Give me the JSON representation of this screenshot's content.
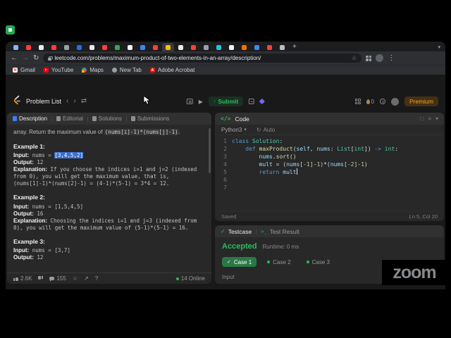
{
  "screen": {
    "watermark": "zoom"
  },
  "icons": {
    "back": "←",
    "forward": "→",
    "reload": "↻",
    "menu": "⋮",
    "star": "☆",
    "caret_down": "▾",
    "chevron_left": "‹",
    "chevron_right": "›",
    "shuffle": "⇄",
    "run": "▶",
    "upload": "↑",
    "share": "↗",
    "help": "?",
    "check": "✓",
    "terminal": ">_",
    "code": "</>",
    "square": "□",
    "lines": "≡"
  },
  "browser": {
    "tab_strip": {
      "favicon_colors": [
        "#8ab4f8",
        "#ff3d3d",
        "#e8eaed",
        "#ff3d3d",
        "#9aa0a6",
        "#1a73e8",
        "#e8eaed",
        "#ff3d3d",
        "#34a853",
        "#f4f4f4",
        "#4285f4",
        "#ff3d3d",
        "#fbbc04",
        "#ececec",
        "#ff3d3d",
        "#9aa0a6",
        "#26c6da",
        "#f1f1f1",
        "#ff6d00",
        "#4285f4",
        "#ff3d3d",
        "#bdbdbd"
      ],
      "active_index": 12,
      "new_tab_label": "+"
    },
    "toolbar": {
      "url": "leetcode.com/problems/maximum-product-of-two-elements-in-an-array/description/"
    },
    "bookmarks": [
      {
        "label": "Gmail",
        "icon": "gmail-icon",
        "bg": "#ffffff",
        "glyph": "M",
        "glyph_color": "#ea4335"
      },
      {
        "label": "YouTube",
        "icon": "youtube-icon",
        "bg": "#ff0000",
        "glyph": "",
        "glyph_color": ""
      },
      {
        "label": "Maps",
        "icon": "maps-icon",
        "bg": "",
        "glyph": "",
        "glyph_color": ""
      },
      {
        "label": "New Tab",
        "icon": "new-tab-icon",
        "bg": "#9aa0a6",
        "glyph": "",
        "glyph_color": ""
      },
      {
        "label": "Adobe Acrobat",
        "icon": "acrobat-icon",
        "bg": "#fa0f00",
        "glyph": "A",
        "glyph_color": "#ffffff"
      }
    ]
  },
  "leetcode": {
    "nav": {
      "problem_list": "Problem List",
      "submit": "Submit",
      "streak": "0",
      "premium": "Premium"
    },
    "description": {
      "tabs": [
        {
          "label": "Description",
          "color": "#3e7eff",
          "active": true
        },
        {
          "label": "Editorial",
          "color": "#8f8f8f",
          "active": false
        },
        {
          "label": "Solutions",
          "color": "#8f8f8f",
          "active": false
        },
        {
          "label": "Submissions",
          "color": "#8f8f8f",
          "active": false
        }
      ],
      "intro_pre": "array. Return the maximum value of ",
      "intro_code": "(nums[i]-1)*(nums[j]-1)",
      "intro_post": ".",
      "examples": [
        {
          "title": "Example 1:",
          "input_label": "Input:",
          "input_pre": " nums = ",
          "input_selected": "[3,4,5,2]",
          "output_label": "Output:",
          "output_value": " 12",
          "explanation_label": "Explanation:",
          "explanation": " If you choose the indices i=1 and j=2 (indexed from 0), you will get the maximum value, that is, (nums[1]-1)*(nums[2]-1) = (4-1)*(5-1) = 3*4 = 12."
        },
        {
          "title": "Example 2:",
          "input_label": "Input:",
          "input_value": " nums = [1,5,4,5]",
          "output_label": "Output:",
          "output_value": " 16",
          "explanation_label": "Explanation:",
          "explanation": " Choosing the indices i=1 and j=3 (indexed from 0), you will get the maximum value of (5-1)*(5-1) = 16."
        },
        {
          "title": "Example 3:",
          "input_label": "Input:",
          "input_value": " nums = [3,7]",
          "output_label": "Output:",
          "output_value": " 12"
        }
      ],
      "footer": {
        "likes": "2.6K",
        "comments": "155",
        "online": "14 Online"
      }
    },
    "code_panel": {
      "title": "Code",
      "language": "Python3",
      "auto": "Auto",
      "lines": [
        [
          {
            "t": "class ",
            "c": "kw"
          },
          {
            "t": "Solution",
            "c": "type"
          },
          {
            "t": ":",
            "c": "pln"
          }
        ],
        [
          {
            "t": "    ",
            "c": "pln"
          },
          {
            "t": "def ",
            "c": "kw"
          },
          {
            "t": "maxProduct",
            "c": "fn"
          },
          {
            "t": "(",
            "c": "pln"
          },
          {
            "t": "self",
            "c": "var"
          },
          {
            "t": ", ",
            "c": "pln"
          },
          {
            "t": "nums",
            "c": "var"
          },
          {
            "t": ": ",
            "c": "pln"
          },
          {
            "t": "List",
            "c": "type"
          },
          {
            "t": "[",
            "c": "pln"
          },
          {
            "t": "int",
            "c": "type"
          },
          {
            "t": "]) ",
            "c": "pln"
          },
          {
            "t": "-> ",
            "c": "kw"
          },
          {
            "t": "int",
            "c": "type"
          },
          {
            "t": ":",
            "c": "pln"
          }
        ],
        [
          {
            "t": "        ",
            "c": "pln"
          },
          {
            "t": "nums",
            "c": "var"
          },
          {
            "t": ".",
            "c": "pln"
          },
          {
            "t": "sort",
            "c": "fn"
          },
          {
            "t": "()",
            "c": "pln"
          }
        ],
        [
          {
            "t": "        ",
            "c": "pln"
          },
          {
            "t": "mult",
            "c": "var"
          },
          {
            "t": " = (",
            "c": "pln"
          },
          {
            "t": "nums",
            "c": "var"
          },
          {
            "t": "[",
            "c": "pln"
          },
          {
            "t": "-1",
            "c": "num"
          },
          {
            "t": "]-",
            "c": "pln"
          },
          {
            "t": "1",
            "c": "num"
          },
          {
            "t": ")*(",
            "c": "pln"
          },
          {
            "t": "nums",
            "c": "var"
          },
          {
            "t": "[",
            "c": "pln"
          },
          {
            "t": "-2",
            "c": "num"
          },
          {
            "t": "]-",
            "c": "pln"
          },
          {
            "t": "1",
            "c": "num"
          },
          {
            "t": ")",
            "c": "pln"
          }
        ],
        [
          {
            "t": "        ",
            "c": "pln"
          },
          {
            "t": "return ",
            "c": "kw"
          },
          {
            "t": "mult",
            "c": "var"
          }
        ],
        [],
        []
      ],
      "saved": "Saved",
      "cursor": "Ln 5, Col 20"
    },
    "test_panel": {
      "tabs": [
        {
          "label": "Testcase",
          "active": true
        },
        {
          "label": "Test Result",
          "active": false
        }
      ],
      "status": "Accepted",
      "runtime": "Runtime: 0 ms",
      "cases": [
        {
          "label": "Case 1",
          "active": true
        },
        {
          "label": "Case 2",
          "active": false
        },
        {
          "label": "Case 3",
          "active": false
        }
      ],
      "input_label": "Input"
    }
  }
}
